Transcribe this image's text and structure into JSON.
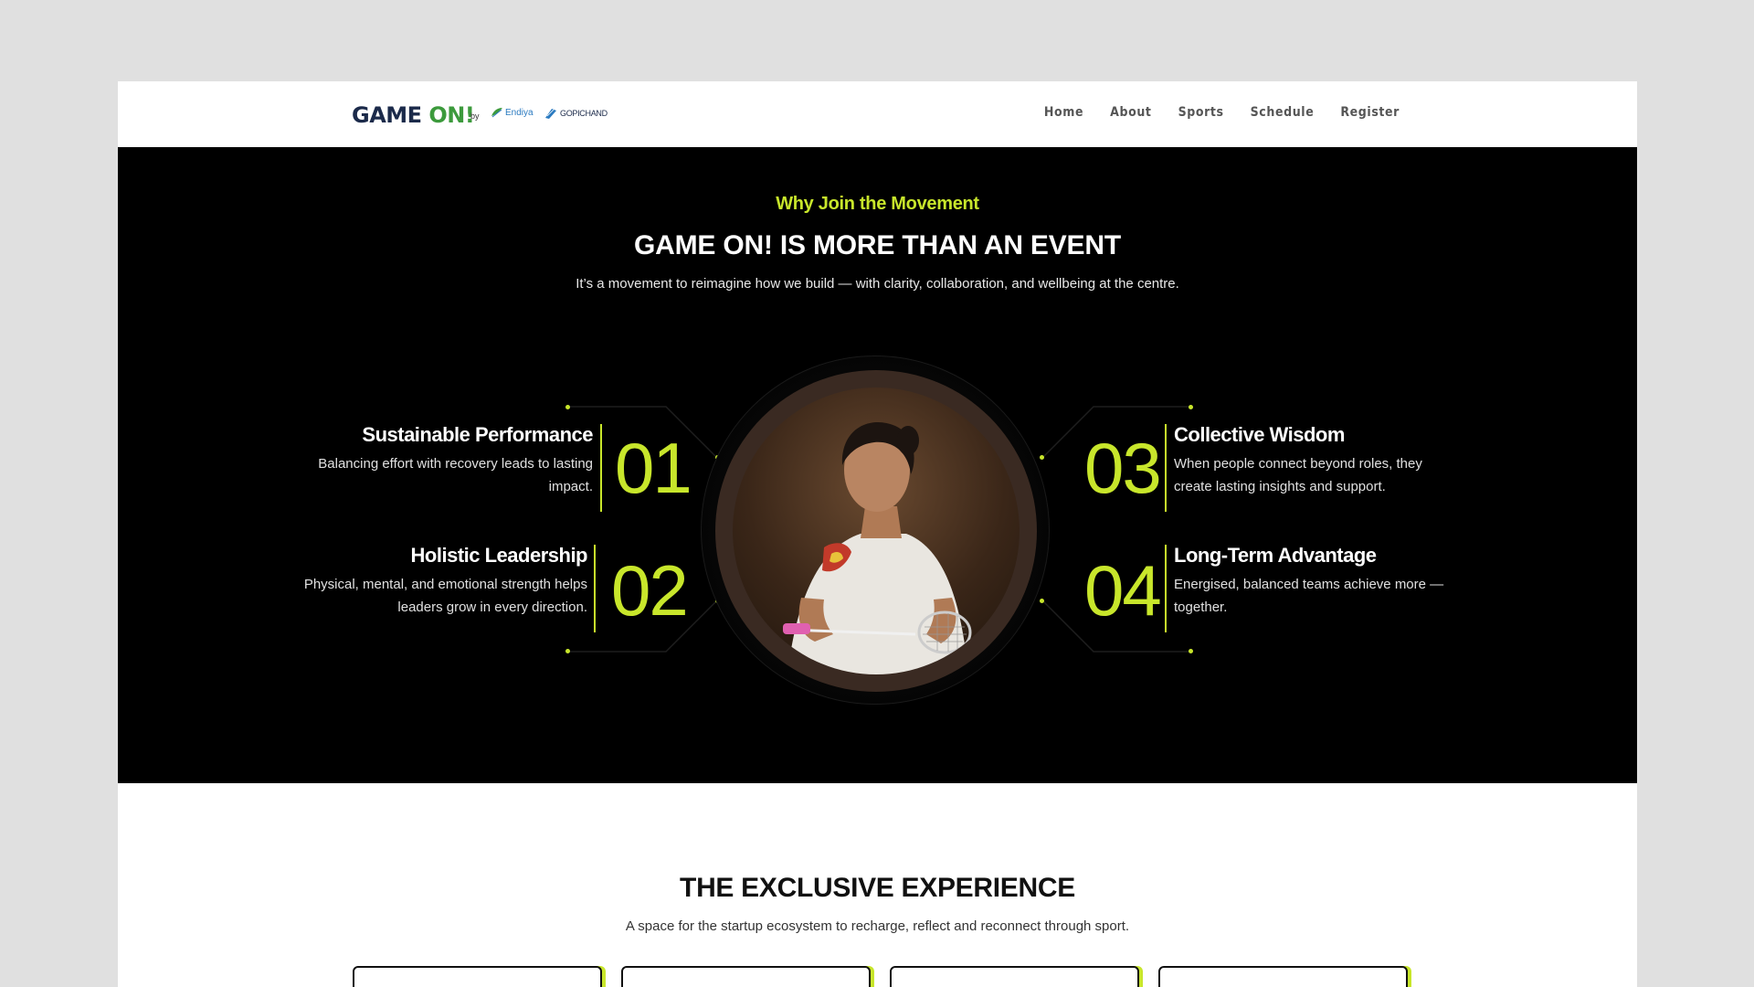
{
  "header": {
    "logo_main": "GAME ",
    "logo_accent": "ON!",
    "by": "by",
    "partner1": "Endiya",
    "partner2": "GOPICHAND",
    "nav": [
      {
        "label": "Home"
      },
      {
        "label": "About"
      },
      {
        "label": "Sports"
      },
      {
        "label": "Schedule"
      },
      {
        "label": "Register"
      }
    ]
  },
  "why": {
    "eyebrow": "Why Join the Movement",
    "title": "GAME ON! IS MORE THAN AN EVENT",
    "lead": "It’s a movement to reimagine how we build — with clarity, collaboration, and wellbeing at the centre.",
    "features": [
      {
        "num": "01",
        "title": "Sustainable Performance",
        "text": "Balancing effort with recovery leads to lasting impact."
      },
      {
        "num": "02",
        "title": "Holistic Leadership",
        "text": "Physical, mental, and emotional strength helps leaders grow in every direction."
      },
      {
        "num": "03",
        "title": "Collective Wisdom",
        "text": "When people connect beyond roles, they create lasting insights and support."
      },
      {
        "num": "04",
        "title": "Long-Term Advantage",
        "text": "Energised, balanced teams achieve more — together."
      }
    ]
  },
  "experience": {
    "title": "THE EXCLUSIVE EXPERIENCE",
    "subtitle": "A space for the startup ecosystem to recharge, reflect and reconnect through sport."
  },
  "colors": {
    "accent": "#c8e62b",
    "dark_bg": "#000000",
    "page_bg": "#e0e0e0",
    "logo_navy": "#1b2a4a",
    "logo_green": "#3c9a3c"
  },
  "icons": [
    "endiya-leaf-icon",
    "gopichand-shuttle-icon"
  ]
}
